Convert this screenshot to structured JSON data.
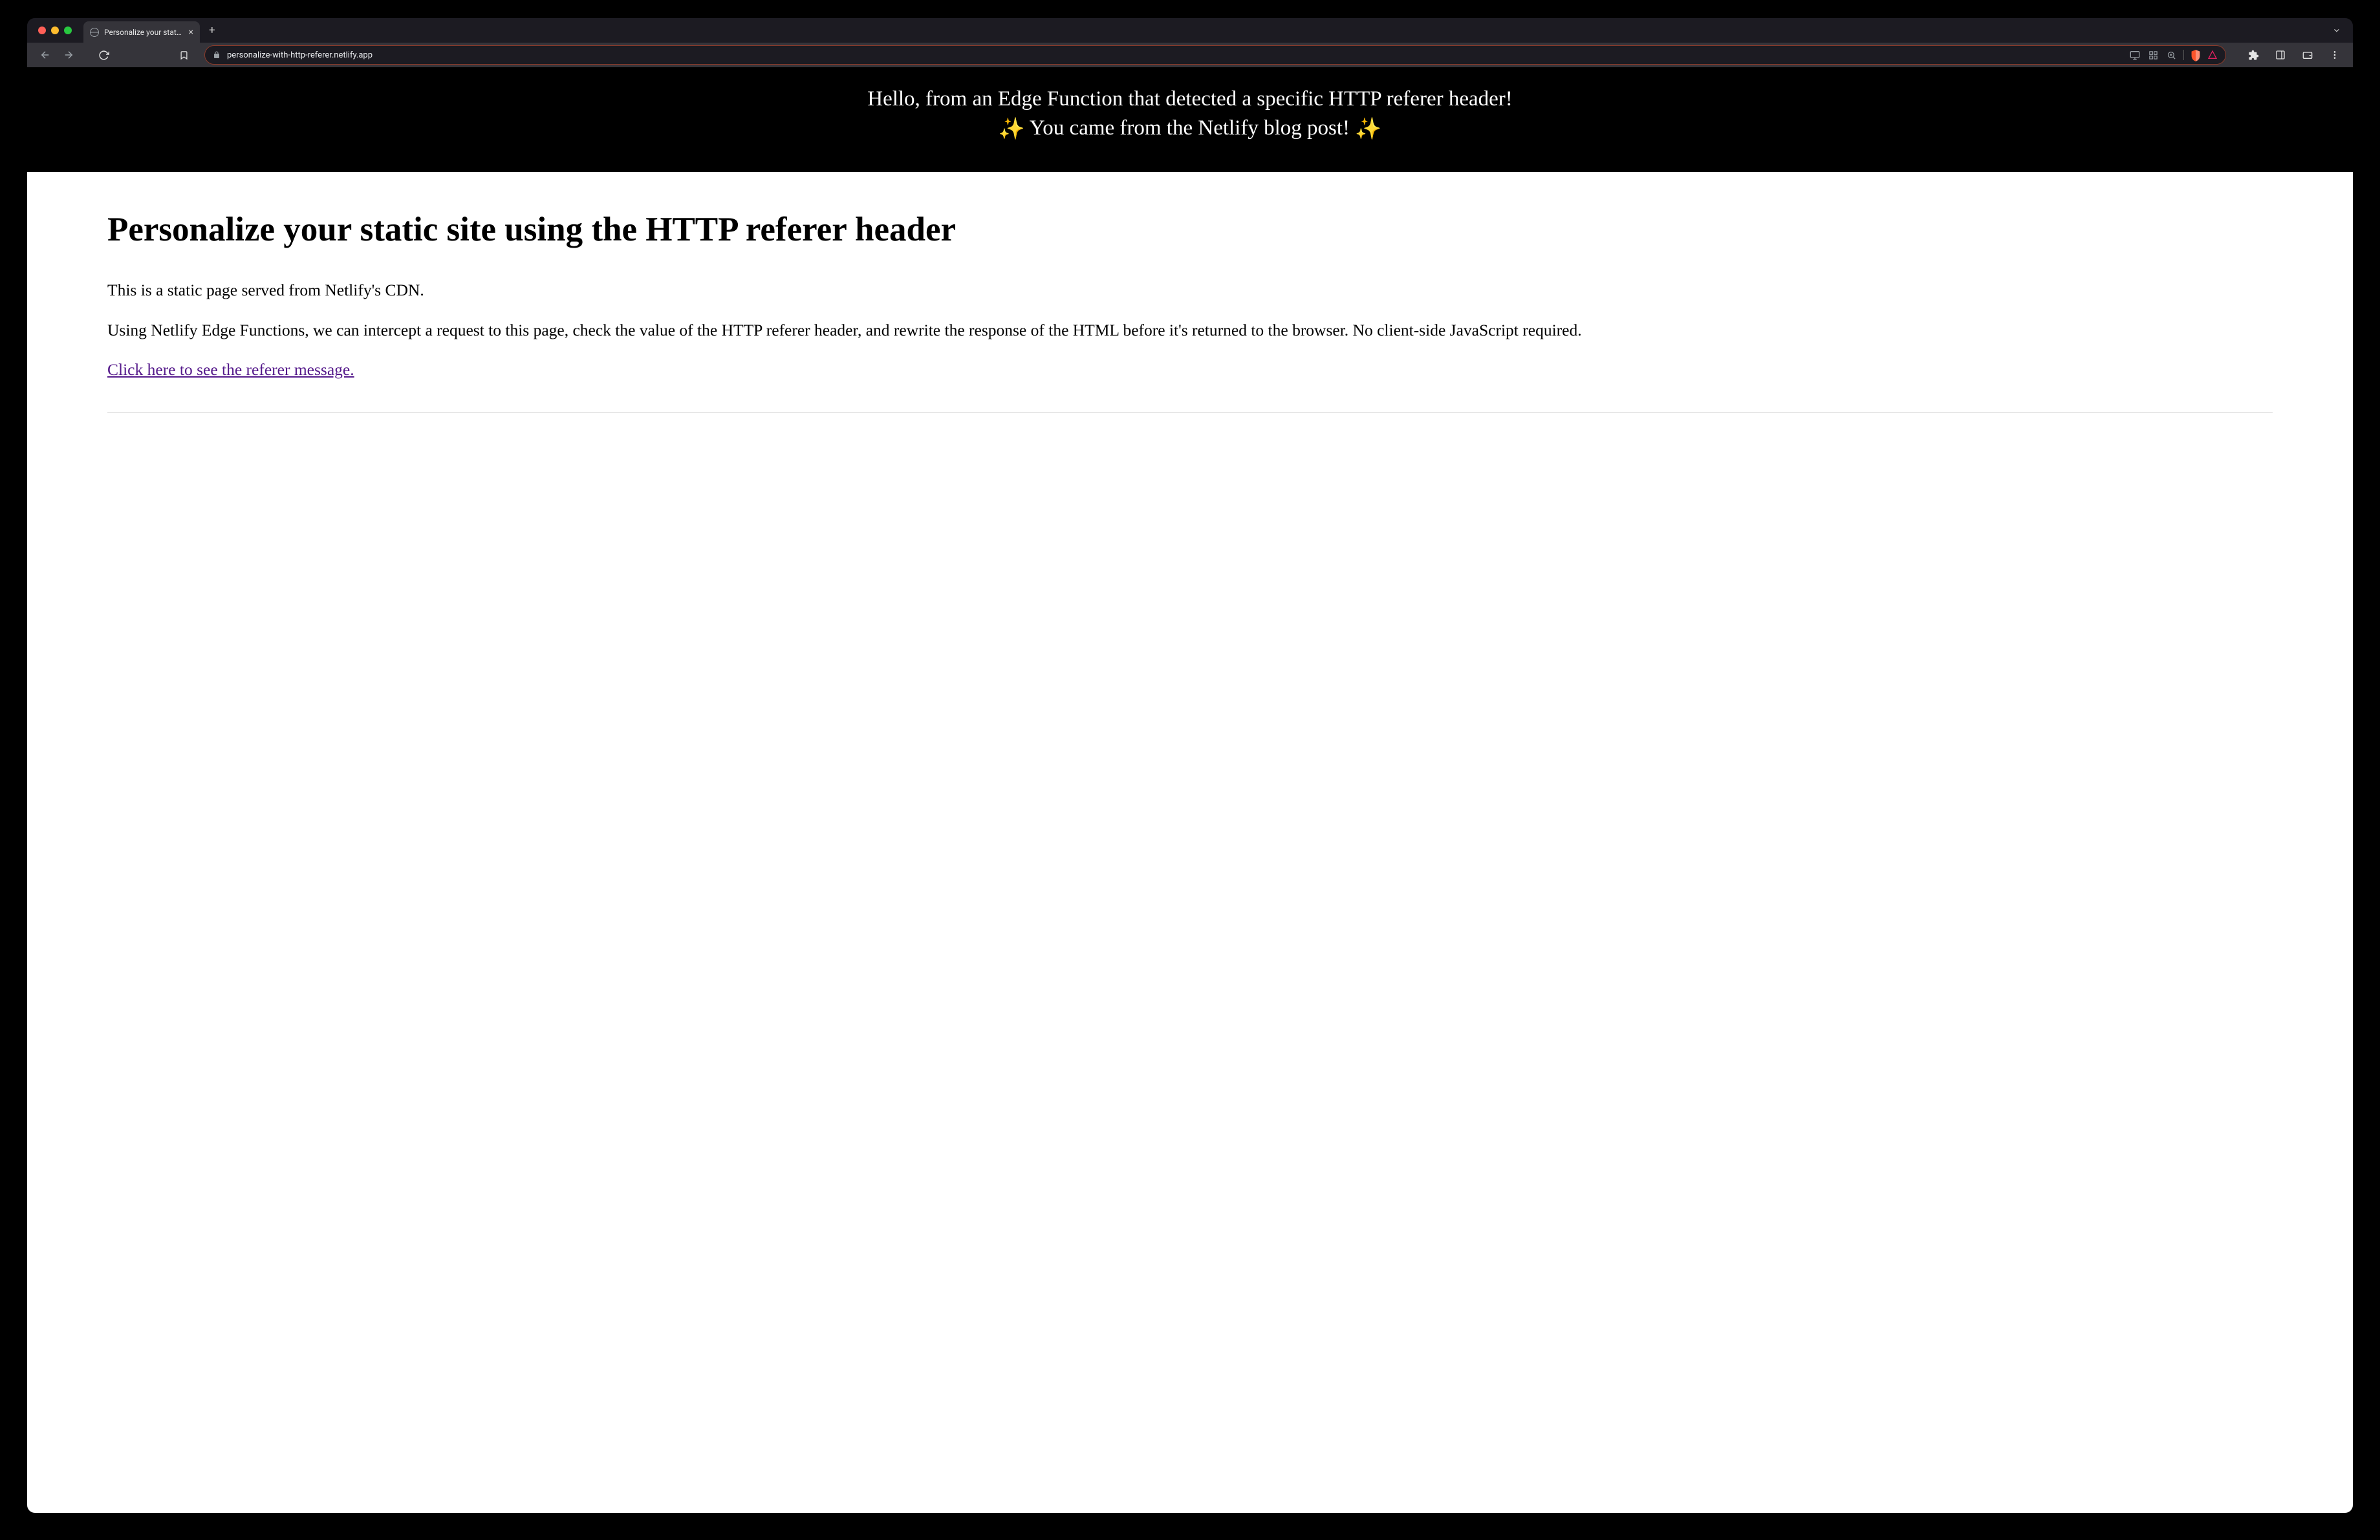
{
  "browser": {
    "tab_title": "Personalize your static site b",
    "url": "personalize-with-http-referer.netlify.app"
  },
  "hero": {
    "line1": "Hello, from an Edge Function that detected a specific HTTP referer header!",
    "line2_prefix": "",
    "line2_text": "You came from the Netlify blog post!",
    "sparkle": "✨"
  },
  "page": {
    "title": "Personalize your static site using the HTTP referer header",
    "para1": "This is a static page served from Netlify's CDN.",
    "para2": "Using Netlify Edge Functions, we can intercept a request to this page, check the value of the HTTP referer header, and rewrite the response of the HTML before it's returned to the browser. No client-side JavaScript required.",
    "link_text": "Click here to see the referer message."
  }
}
